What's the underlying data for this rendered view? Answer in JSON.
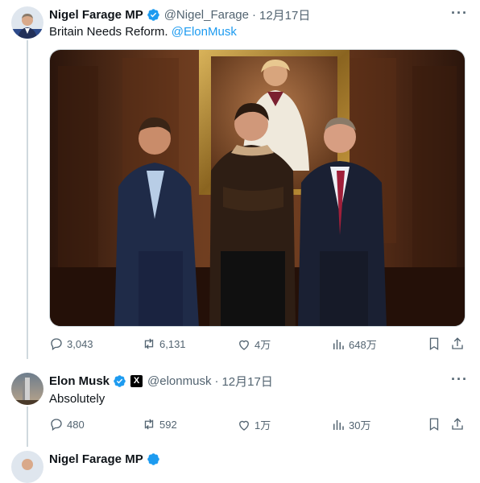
{
  "tweet1": {
    "display_name": "Nigel Farage MP",
    "handle": "@Nigel_Farage",
    "separator": "·",
    "date": "12月17日",
    "text": "Britain Needs Reform.",
    "mention": "@ElonMusk",
    "more": "···",
    "metrics": {
      "replies": "3,043",
      "reposts": "6,131",
      "likes": "4万",
      "views": "648万"
    }
  },
  "tweet2": {
    "display_name": "Elon Musk",
    "handle": "@elonmusk",
    "separator": "·",
    "date": "12月17日",
    "text": "Absolutely",
    "more": "···",
    "badge": "X",
    "metrics": {
      "replies": "480",
      "reposts": "592",
      "likes": "1万",
      "views": "30万"
    }
  },
  "tweet3": {
    "display_name": "Nigel Farage MP"
  },
  "colors": {
    "verified": "#1d9bf0",
    "link": "#1d9bf0",
    "muted": "#536471",
    "thread_line": "#cfd9de"
  },
  "icons": [
    "reply-icon",
    "repost-icon",
    "like-icon",
    "views-icon",
    "bookmark-icon",
    "share-icon",
    "verified-badge-icon",
    "more-icon"
  ]
}
